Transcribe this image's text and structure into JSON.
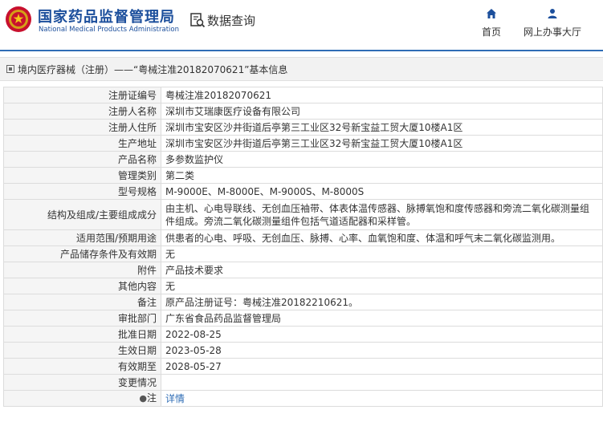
{
  "header": {
    "brand_cn": "国家药品监督管理局",
    "brand_en": "National Medical Products Administration",
    "query_label": "数据查询",
    "nav_home": "首页",
    "nav_online": "网上办事大厅"
  },
  "breadcrumb": {
    "text": "境内医疗器械（注册）——“粤械注准20182070621”基本信息"
  },
  "rows": [
    {
      "label": "注册证编号",
      "value": "粤械注准20182070621"
    },
    {
      "label": "注册人名称",
      "value": "深圳市艾瑞康医疗设备有限公司"
    },
    {
      "label": "注册人住所",
      "value": "深圳市宝安区沙井街道后亭第三工业区32号新宝益工贸大厦10楼A1区"
    },
    {
      "label": "生产地址",
      "value": "深圳市宝安区沙井街道后亭第三工业区32号新宝益工贸大厦10楼A1区"
    },
    {
      "label": "产品名称",
      "value": "多参数监护仪"
    },
    {
      "label": "管理类别",
      "value": "第二类"
    },
    {
      "label": "型号规格",
      "value": "M-9000E、M-8000E、M-9000S、M-8000S"
    },
    {
      "label": "结构及组成/主要组成成分",
      "value": "由主机、心电导联线、无创血压袖带、体表体温传感器、脉搏氧饱和度传感器和旁流二氧化碳测量组件组成。旁流二氧化碳测量组件包括气道适配器和采样管。"
    },
    {
      "label": "适用范围/预期用途",
      "value": "供患者的心电、呼吸、无创血压、脉搏、心率、血氧饱和度、体温和呼气末二氧化碳监测用。"
    },
    {
      "label": "产品储存条件及有效期",
      "value": "无"
    },
    {
      "label": "附件",
      "value": "产品技术要求"
    },
    {
      "label": "其他内容",
      "value": "无"
    },
    {
      "label": "备注",
      "value": "原产品注册证号：粤械注准20182210621。"
    },
    {
      "label": "审批部门",
      "value": "广东省食品药品监督管理局"
    },
    {
      "label": "批准日期",
      "value": "2022-08-25"
    },
    {
      "label": "生效日期",
      "value": "2023-05-28"
    },
    {
      "label": "有效期至",
      "value": "2028-05-27"
    },
    {
      "label": "变更情况",
      "value": ""
    }
  ],
  "note_row": {
    "icon": "lightbulb-icon",
    "label": "注",
    "link": "详情"
  },
  "colors": {
    "brand": "#1c4f9c",
    "accent": "#2f6db5",
    "label_bg": "#f5f5f5"
  }
}
